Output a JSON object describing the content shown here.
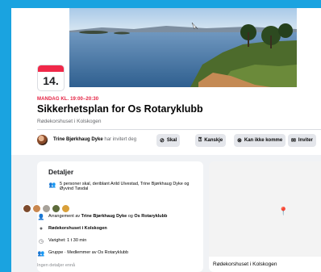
{
  "event": {
    "day": "14.",
    "when": "MANDAG KL. 19:00–20:30",
    "title": "Sikkerhetsplan for Os Rotaryklubb",
    "location_sub": "Rødekorshuset i Kolskogen"
  },
  "invite": {
    "inviter": "Trine Bjørkhaug Dyke",
    "suffix": "har invitert deg",
    "buttons": {
      "going": "Skal",
      "maybe": "Kanskje",
      "cant": "Kan ikke komme",
      "invite": "Inviter",
      "more": "···"
    }
  },
  "details": {
    "heading": "Detaljer",
    "guests_line1": "5 personer skal, deriblant Arild Ulvestad, Trine Bjørkhaug Dyke og",
    "guests_line2": "Øyvind Tøsdal",
    "organizer_prefix": "Arrangement av",
    "organizer_name": "Trine Bjørkhaug Dyke",
    "organizer_and": "og",
    "organizer_club": "Os Rotaryklubb",
    "place": "Rødekorshuset i Kolskogen",
    "duration": "Varighet: 1 t 30 min",
    "group": "Gruppe · Medlemmer av Os Rotaryklubb",
    "no_details": "Ingen detaljer ennå"
  },
  "map": {
    "caption": "Rødekorshuset i Kolskogen"
  },
  "colors": {
    "background": "#1aa3e0",
    "date_accent": "#f02849",
    "when_text": "#e41e3f",
    "map_pin": "#e9573e"
  }
}
